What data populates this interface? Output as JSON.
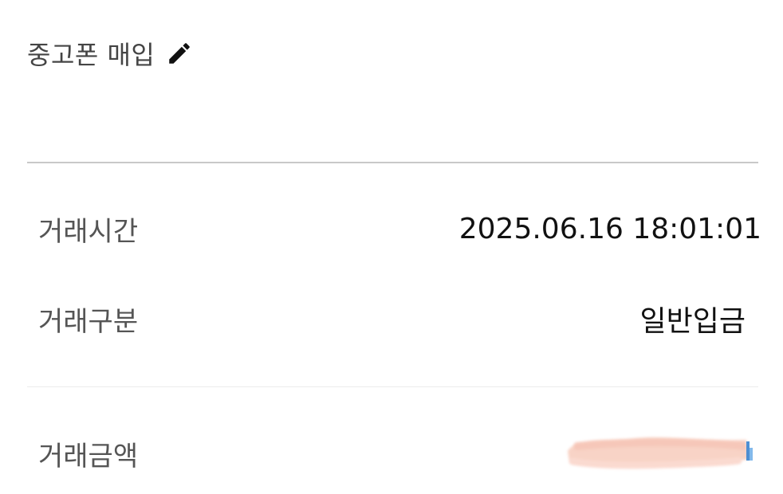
{
  "header": {
    "title": "중고폰 매입",
    "edit_icon": "pencil-icon"
  },
  "details": {
    "time": {
      "label": "거래시간",
      "value": "2025.06.16 18:01:01"
    },
    "type": {
      "label": "거래구분",
      "value": "일반입금"
    },
    "amount": {
      "label": "거래금액",
      "value_state": "masked"
    }
  },
  "colors": {
    "text_primary": "#111111",
    "text_label": "#555555",
    "divider": "#c8c8c8",
    "mask": "#f8cfc0",
    "mask_accent": "#2f7fd0"
  }
}
